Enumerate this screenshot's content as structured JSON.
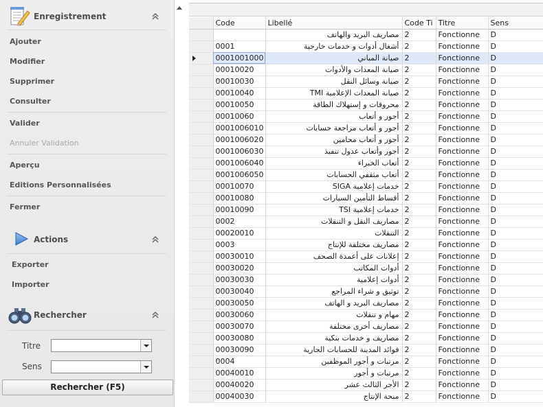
{
  "tasks": {
    "enregistrement": {
      "title": "Enregistrement",
      "items": [
        "Ajouter",
        "Modifier",
        "Supprimer",
        "Consulter",
        "Valider",
        "Annuler Validation",
        "Aperçu",
        "Editions Personnalisées",
        "Fermer"
      ]
    },
    "actions": {
      "title": "Actions",
      "items": [
        "Exporter",
        "Importer"
      ]
    },
    "rechercher": {
      "title": "Rechercher",
      "fields": [
        {
          "label": "Titre",
          "value": ""
        },
        {
          "label": "Sens",
          "value": ""
        }
      ],
      "button": "Rechercher (F5)"
    }
  },
  "grid": {
    "columns": [
      "Code",
      "Libellé",
      "Code Ti",
      "Titre",
      "Sens"
    ],
    "selected_row": 2,
    "rows": [
      [
        "",
        "مصاريف البريد والهاتف",
        "2",
        "Fonctionne",
        "D"
      ],
      [
        "0001",
        "أشغال أدوات و خدمات خارجية",
        "2",
        "Fonctionne",
        "D"
      ],
      [
        "0001001000",
        "صيانة المباني",
        "2",
        "Fonctionne",
        "D"
      ],
      [
        "00010020",
        "صيانة المعدات والأدوات",
        "2",
        "Fonctionne",
        "D"
      ],
      [
        "00010030",
        "صيانة وسائل النقل",
        "2",
        "Fonctionne",
        "D"
      ],
      [
        "00010040",
        "صيانة المعدات الإعلامية TMI",
        "2",
        "Fonctionne",
        "D"
      ],
      [
        "00010050",
        "محروقات و إستهلاك الطاقة",
        "2",
        "Fonctionne",
        "D"
      ],
      [
        "00010060",
        "أجور و أتعاب",
        "2",
        "Fonctionne",
        "D"
      ],
      [
        "0001006010",
        "أجور و أتعاب مراجعة حسابات",
        "2",
        "Fonctionne",
        "D"
      ],
      [
        "0001006020",
        "أجور و أتعاب محامين",
        "2",
        "Fonctionne",
        "D"
      ],
      [
        "0001006030",
        "أجور وأتعاب عدول تنفيذ",
        "2",
        "Fonctionne",
        "D"
      ],
      [
        "0001006040",
        "أتعاب الخبراء",
        "2",
        "Fonctionne",
        "D"
      ],
      [
        "0001006050",
        "أتعاب مثقفي الحسابات",
        "2",
        "Fonctionne",
        "D"
      ],
      [
        "00010070",
        "خدمات إعلامية SIGA",
        "2",
        "Fonctionne",
        "D"
      ],
      [
        "00010080",
        "أقساط التأمين السيارات",
        "2",
        "Fonctionne",
        "D"
      ],
      [
        "00010090",
        "خدمات إعلامية TSI",
        "2",
        "Fonctionne",
        "D"
      ],
      [
        "0002",
        "مصاريف النقل و التنقلات",
        "2",
        "Fonctionne",
        "D"
      ],
      [
        "00020010",
        "التنقلات",
        "2",
        "Fonctionne",
        "D"
      ],
      [
        "0003",
        "مصاريف مختلفة للإنتاج",
        "2",
        "Fonctionne",
        "D"
      ],
      [
        "00030010",
        "إعلانات على أعمدة الصحف",
        "2",
        "Fonctionne",
        "D"
      ],
      [
        "00030020",
        "أدوات المكاتب",
        "2",
        "Fonctionne",
        "D"
      ],
      [
        "00030030",
        "أدوات إعلامية",
        "2",
        "Fonctionne",
        "D"
      ],
      [
        "00030040",
        "توثيق و شراء المراجع",
        "2",
        "Fonctionne",
        "D"
      ],
      [
        "00030050",
        "مصاريف البريد و الهاتف",
        "2",
        "Fonctionne",
        "D"
      ],
      [
        "00030060",
        "مهام و تنقلات",
        "2",
        "Fonctionne",
        "D"
      ],
      [
        "00030070",
        "مصاريف أخرى مختلفة",
        "2",
        "Fonctionne",
        "D"
      ],
      [
        "00030080",
        "مصاريف و خدمات بنكية",
        "2",
        "Fonctionne",
        "D"
      ],
      [
        "00030090",
        "فوائد المدينة للحسابات الجارية",
        "2",
        "Fonctionne",
        "D"
      ],
      [
        "0004",
        "مرتبات و أجور الموظفين",
        "2",
        "Fonctionne",
        "D"
      ],
      [
        "00040010",
        "مرتبات و أجور",
        "2",
        "Fonctionne",
        "D"
      ],
      [
        "00040020",
        "الأجر الثالث عشر",
        "2",
        "Fonctionne",
        "D"
      ],
      [
        "00040030",
        "منحة الإنتاج",
        "2",
        "Fonctionne",
        "D"
      ]
    ]
  },
  "colors": {
    "selection": "#dfe8f8",
    "pane_background": "#ececec",
    "accent": "#3a7bd5"
  },
  "icons": {
    "enregistrement": "notepad-pencil-icon",
    "actions": "play-triangle-icon",
    "rechercher": "binoculars-icon",
    "collapse": "double-chevron-up-icon",
    "row_indicator": "row-pointer-icon",
    "dropdown": "dropdown-arrow-icon"
  }
}
